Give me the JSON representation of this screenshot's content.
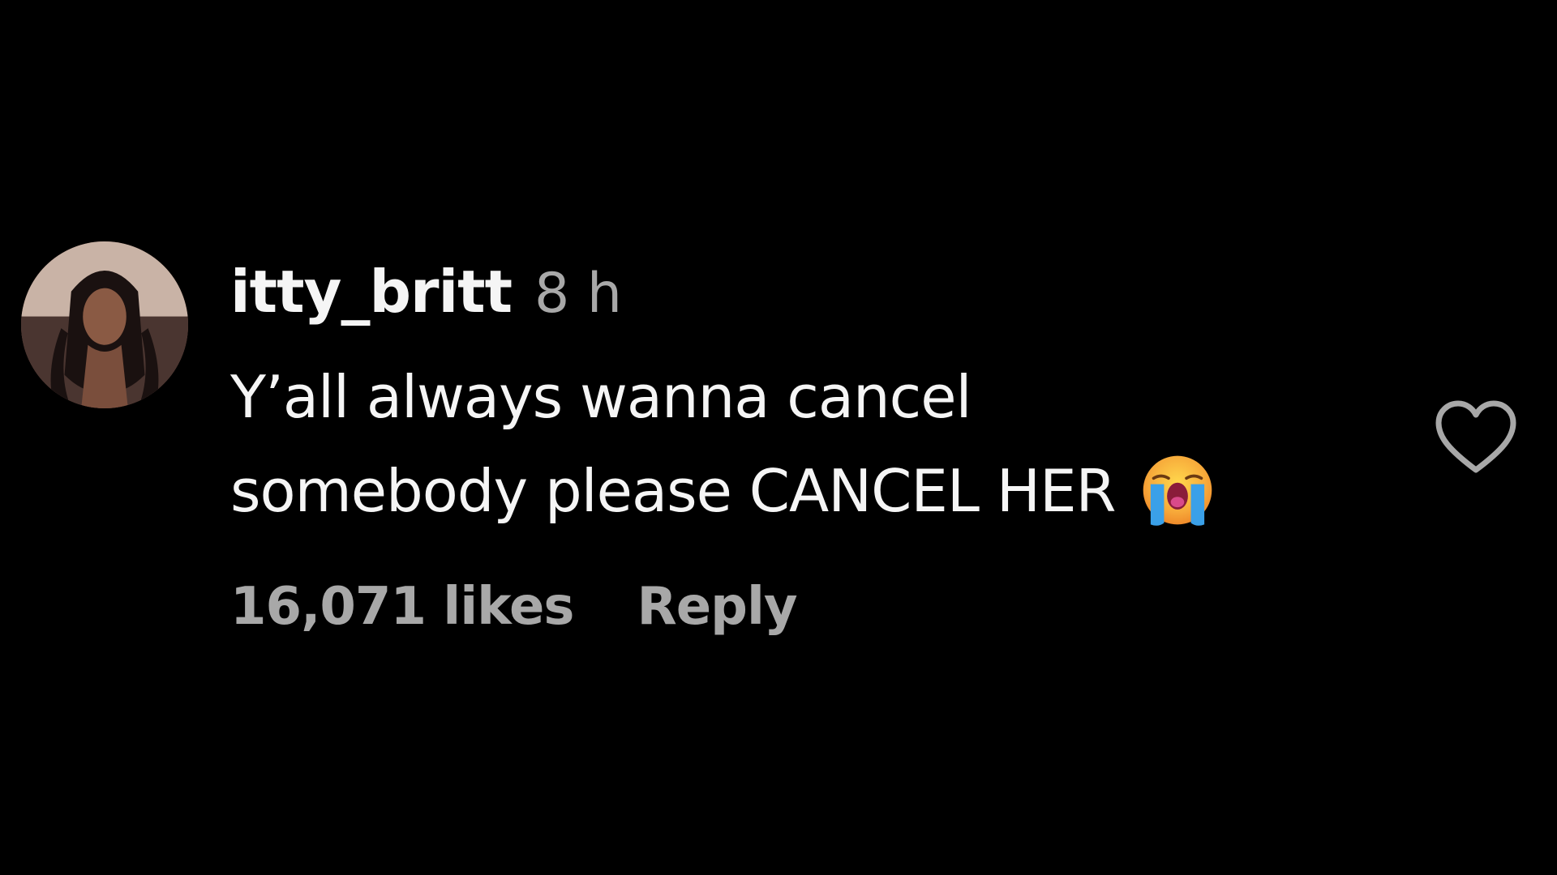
{
  "comment": {
    "username": "itty_britt",
    "timestamp": "8 h",
    "text_line_1": "Y’all always wanna cancel",
    "text_line_2": "somebody please CANCEL HER",
    "emoji": "loudly-crying-face-icon",
    "likes": "16,071 likes",
    "reply_label": "Reply",
    "like_icon": "heart-outline-icon"
  },
  "colors": {
    "background": "#000000",
    "primary_text": "#f5f5f5",
    "secondary_text": "#a8a8a8"
  }
}
